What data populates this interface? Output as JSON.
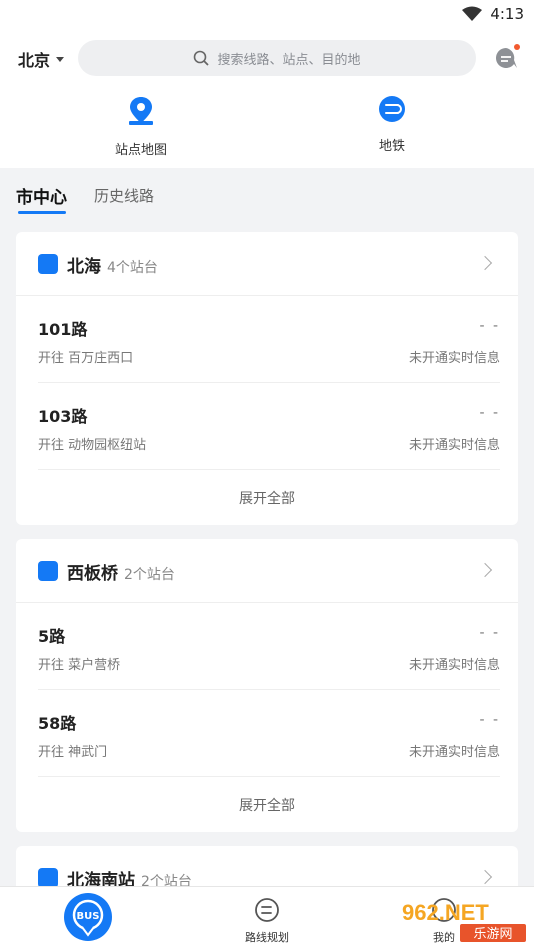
{
  "status_bar": {
    "time": "4:13"
  },
  "header": {
    "city": "北京",
    "search_placeholder": "搜索线路、站点、目的地"
  },
  "quick_actions": [
    {
      "label": "站点地图",
      "icon": "map-pin-icon"
    },
    {
      "label": "地铁",
      "icon": "subway-icon"
    }
  ],
  "tabs": {
    "active": "市中心",
    "other": "历史线路"
  },
  "cards": [
    {
      "station": "北海",
      "count": "4个站台",
      "lines": [
        {
          "name": "101路",
          "direction": "开往 百万庄西口",
          "eta": "- -",
          "realtime": "未开通实时信息"
        },
        {
          "name": "103路",
          "direction": "开往 动物园枢纽站",
          "eta": "- -",
          "realtime": "未开通实时信息"
        }
      ],
      "expand": "展开全部"
    },
    {
      "station": "西板桥",
      "count": "2个站台",
      "lines": [
        {
          "name": "5路",
          "direction": "开往 菜户营桥",
          "eta": "- -",
          "realtime": "未开通实时信息"
        },
        {
          "name": "58路",
          "direction": "开往 神武门",
          "eta": "- -",
          "realtime": "未开通实时信息"
        }
      ],
      "expand": "展开全部"
    },
    {
      "station": "北海南站",
      "count": "2个站台"
    }
  ],
  "bottom_nav": {
    "bus_label": "BUS",
    "route_plan": "路线规划",
    "mine": "我的"
  },
  "watermark": {
    "text": "962.NET",
    "subtext": "乐游网"
  },
  "colors": {
    "accent": "#1479f5",
    "notification": "#f25a2f"
  }
}
